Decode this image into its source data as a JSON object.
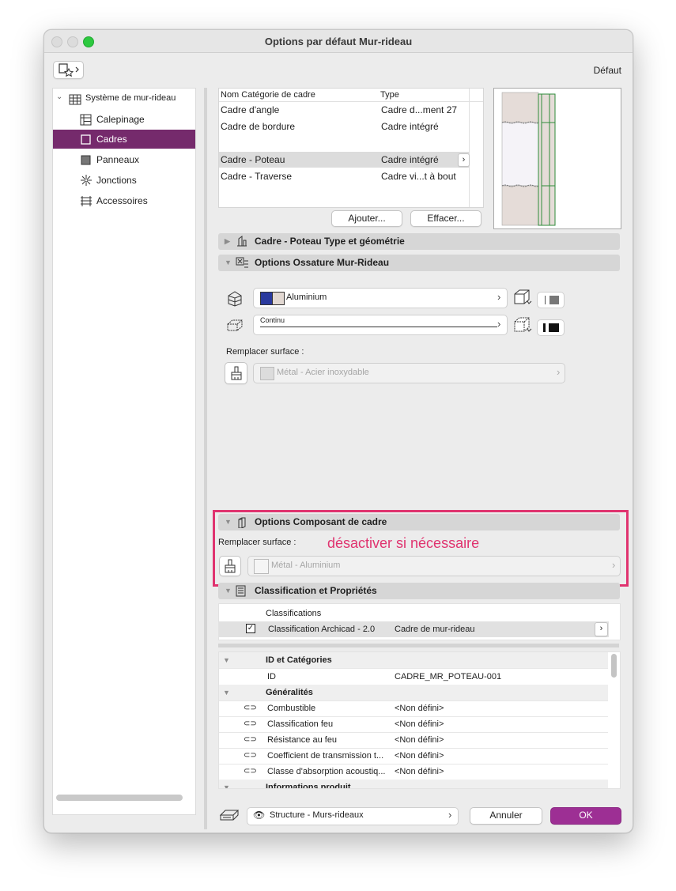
{
  "window": {
    "title": "Options par défaut Mur-rideau",
    "default_label": "Défaut"
  },
  "sidebar": {
    "root": "Système de mur-rideau",
    "items": [
      {
        "label": "Calepinage",
        "icon": "grid-layout-icon"
      },
      {
        "label": "Cadres",
        "icon": "frame-icon",
        "selected": true
      },
      {
        "label": "Panneaux",
        "icon": "panel-icon"
      },
      {
        "label": "Jonctions",
        "icon": "junction-icon"
      },
      {
        "label": "Accessoires",
        "icon": "accessories-icon"
      }
    ]
  },
  "frame_table": {
    "headers": [
      "Nom Catégorie de cadre",
      "Type"
    ],
    "rows": [
      {
        "name": "Cadre d'angle",
        "type": "Cadre d...ment 27"
      },
      {
        "name": "Cadre de bordure",
        "type": "Cadre intégré"
      },
      {
        "name": "",
        "type": ""
      },
      {
        "name": "Cadre - Poteau",
        "type": "Cadre intégré",
        "selected": true
      },
      {
        "name": "Cadre - Traverse",
        "type": "Cadre vi...t à bout"
      }
    ],
    "add_label": "Ajouter...",
    "delete_label": "Effacer..."
  },
  "sections": {
    "type_geometry": "Cadre - Poteau Type et géométrie",
    "ossature": "Options Ossature Mur-Rideau",
    "component": "Options Composant de cadre",
    "classification": "Classification et Propriétés"
  },
  "ossature": {
    "material": "Aluminium",
    "line": "Continu",
    "override_label": "Remplacer surface :",
    "surface": "Métal - Acier inoxydable"
  },
  "component": {
    "override_label": "Remplacer surface :",
    "annotation": "désactiver si nécessaire",
    "surface": "Métal - Aluminium"
  },
  "classification": {
    "header": "Classifications",
    "system": "Classification Archicad - 2.0",
    "value": "Cadre de mur-rideau"
  },
  "properties": {
    "group1": "ID et Catégories",
    "id_label": "ID",
    "id_value": "CADRE_MR_POTEAU-001",
    "group2": "Généralités",
    "rows": [
      {
        "label": "Combustible",
        "value": "<Non défini>"
      },
      {
        "label": "Classification feu",
        "value": "<Non défini>"
      },
      {
        "label": "Résistance au feu",
        "value": "<Non défini>"
      },
      {
        "label": "Coefficient de transmission t...",
        "value": "<Non défini>"
      },
      {
        "label": "Classe d'absorption acoustiq...",
        "value": "<Non défini>"
      }
    ],
    "group3": "Informations produit"
  },
  "footer": {
    "layer": "Structure - Murs-rideaux",
    "cancel": "Annuler",
    "ok": "OK"
  },
  "colors": {
    "accent": "#752a6c",
    "annotation": "#e0336f",
    "material_blue": "#2a3a9e"
  }
}
